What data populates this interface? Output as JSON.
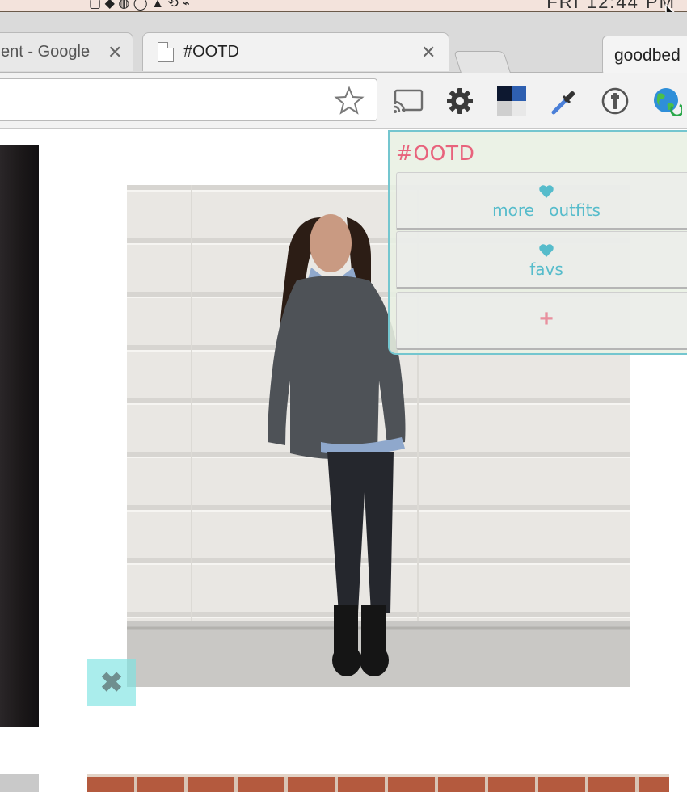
{
  "browser": {
    "tabs": [
      {
        "title": "ent - Google"
      },
      {
        "title": "#OOTD"
      }
    ],
    "tab_close_glyph": "✕",
    "profile_name": "goodbed",
    "menubar_clock": "FRI 12:44 PM",
    "toolbar_icons": [
      "cast-icon",
      "gear-icon",
      "checker-extension-icon",
      "eyedropper-icon",
      "password-manager-icon",
      "globe-refresh-icon"
    ]
  },
  "popup": {
    "title": "#OOTD",
    "items": [
      {
        "icon": "heart-icon",
        "label": "more outfits"
      },
      {
        "icon": "heart-icon",
        "label": "favs"
      },
      {
        "icon": "plus-icon",
        "label": "+"
      }
    ]
  },
  "page": {
    "remove_glyph": "✖"
  },
  "colors": {
    "accent_pink": "#e8637c",
    "accent_teal": "#56bccb",
    "popup_border": "#74c6cf",
    "remove_overlay": "#7de4e2"
  }
}
